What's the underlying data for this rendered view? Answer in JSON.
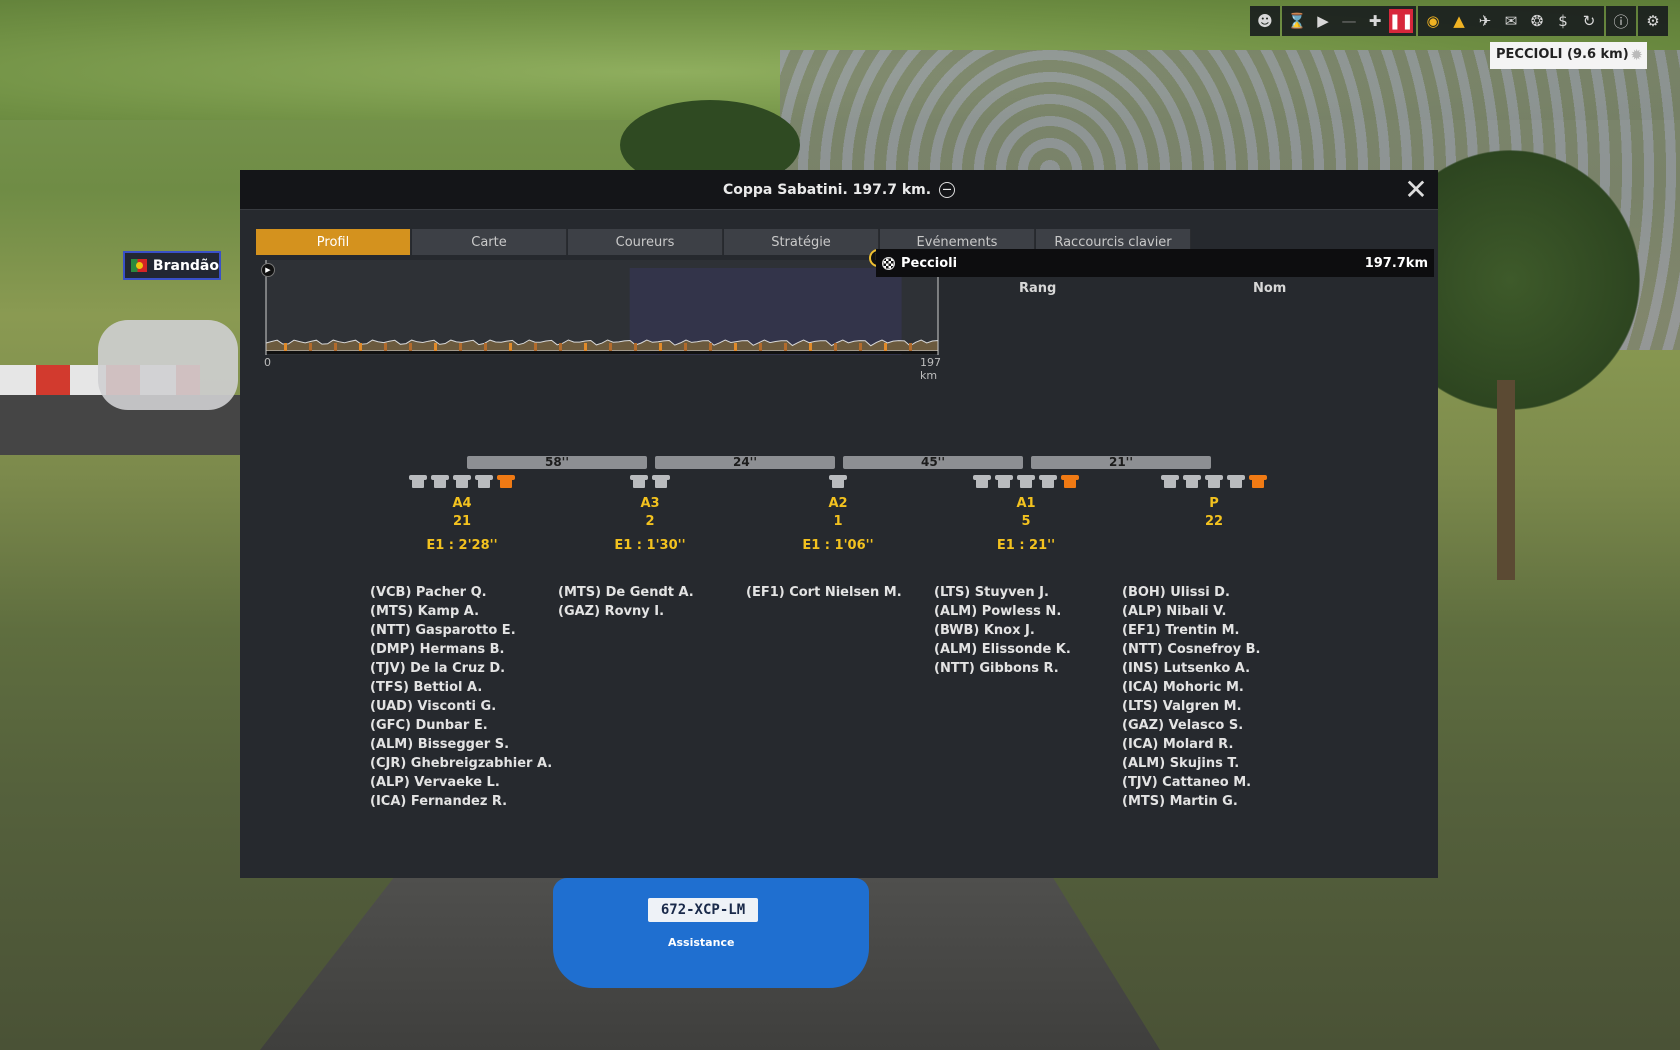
{
  "toolbar": {
    "location": "PECCIOLI (9.6 km)",
    "icons": [
      "person-icon",
      "hourglass-icon",
      "play-icon",
      "minus-icon",
      "plus-icon",
      "pause-icon",
      "eye-icon",
      "helmet-icon",
      "motorbike-icon",
      "helicopter-icon",
      "wheel-icon",
      "dollar-icon",
      "refresh-icon",
      "info-icon",
      "gear-icon"
    ]
  },
  "rider_label": {
    "name": "Brandão"
  },
  "car": {
    "plate": "672-XCP-LM",
    "text": "Assistance"
  },
  "modal": {
    "title": "Coppa Sabatini. 197.7 km.",
    "tabs": [
      {
        "label": "Profil",
        "active": true
      },
      {
        "label": "Carte"
      },
      {
        "label": "Coureurs"
      },
      {
        "label": "Stratégie"
      },
      {
        "label": "Evénements"
      },
      {
        "label": "Raccourcis clavier"
      }
    ],
    "profile": {
      "start_label": "0",
      "end_label": "197 km",
      "total_km": 197.7,
      "highlight_km": [
        107,
        187
      ]
    },
    "finish": {
      "name": "Peccioli",
      "distance": "197.7km",
      "col_rank": "Rang",
      "col_name": "Nom"
    },
    "gaps": [
      "58''",
      "24''",
      "45''",
      "21''"
    ],
    "groups": [
      {
        "name": "A4",
        "count": "21",
        "time": "E1 : 2'28''",
        "jerseys": [
          "w",
          "w",
          "w",
          "w",
          "o"
        ],
        "riders": [
          "(VCB) Pacher Q.",
          "(MTS) Kamp A.",
          "(NTT) Gasparotto E.",
          "(DMP) Hermans B.",
          "(TJV) De la Cruz D.",
          "(TFS) Bettiol A.",
          "(UAD) Visconti G.",
          "(GFC) Dunbar E.",
          "(ALM) Bissegger S.",
          "(CJR) Ghebreigzabhier A.",
          "(ALP) Vervaeke L.",
          "(ICA) Fernandez R."
        ]
      },
      {
        "name": "A3",
        "count": "2",
        "time": "E1 : 1'30''",
        "jerseys": [
          "w",
          "w"
        ],
        "riders": [
          "(MTS) De Gendt A.",
          "(GAZ) Rovny I."
        ]
      },
      {
        "name": "A2",
        "count": "1",
        "time": "E1 : 1'06''",
        "jerseys": [
          "w"
        ],
        "riders": [
          "(EF1) Cort Nielsen M."
        ]
      },
      {
        "name": "A1",
        "count": "5",
        "time": "E1 : 21''",
        "jerseys": [
          "w",
          "w",
          "w",
          "w",
          "o"
        ],
        "riders": [
          "(LTS) Stuyven J.",
          "(ALM) Powless N.",
          "(BWB) Knox J.",
          "(ALM) Elissonde K.",
          "(NTT) Gibbons R."
        ]
      },
      {
        "name": "P",
        "count": "22",
        "time": "",
        "jerseys": [
          "w",
          "w",
          "w",
          "w",
          "o"
        ],
        "riders": [
          "(BOH) Ulissi D.",
          "(ALP) Nibali V.",
          "(EF1) Trentin M.",
          "(NTT) Cosnefroy B.",
          "(INS) Lutsenko A.",
          "(ICA) Mohoric M.",
          "(LTS) Valgren M.",
          "(GAZ) Velasco S.",
          "(ICA) Molard R.",
          "(ALM) Skujins T.",
          "(TJV) Cattaneo M.",
          "(MTS) Martin G."
        ]
      }
    ]
  }
}
